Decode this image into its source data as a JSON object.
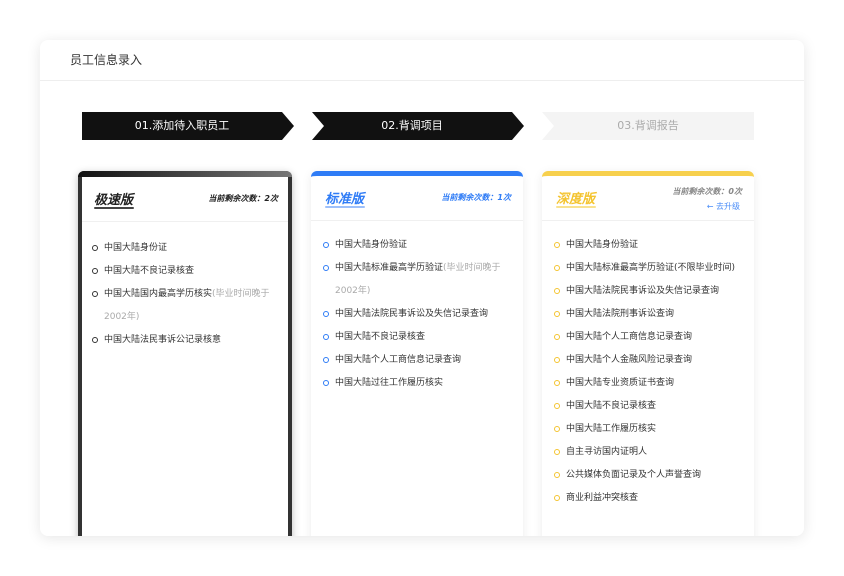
{
  "header": {
    "title": "员工信息录入"
  },
  "steps": [
    {
      "label": "01.添加待入职员工",
      "state": "done"
    },
    {
      "label": "02.背调项目",
      "state": "active"
    },
    {
      "label": "03.背调报告",
      "state": "pending"
    }
  ],
  "colors": {
    "step_active": "#111111",
    "step_pending": "#f4f4f4",
    "standard_accent": "#2f7cf6",
    "deep_accent": "#f7d04d",
    "fast_accent": "#333333"
  },
  "cards": [
    {
      "name": "极速版",
      "remaining": "当前剩余次数：2次",
      "items": [
        {
          "text": "中国大陆身份证",
          "note": ""
        },
        {
          "text": "中国大陆不良记录核查",
          "note": ""
        },
        {
          "text": "中国大陆国内最高学历核实",
          "note": "(毕业时间晚于2002年)"
        },
        {
          "text": "中国大陆法民事诉公记录核意",
          "note": ""
        }
      ]
    },
    {
      "name": "标准版",
      "remaining": "当前剩余次数：1次",
      "items": [
        {
          "text": "中国大陆身份验证",
          "note": ""
        },
        {
          "text": "中国大陆标准最高学历验证",
          "note": "(毕业时间晚于2002年)"
        },
        {
          "text": "中国大陆法院民事诉讼及失信记录查询",
          "note": ""
        },
        {
          "text": "中国大陆不良记录核查",
          "note": ""
        },
        {
          "text": "中国大陆个人工商信息记录查询",
          "note": ""
        },
        {
          "text": "中国大陆过往工作履历核实",
          "note": ""
        }
      ]
    },
    {
      "name": "深度版",
      "remaining": "当前剩余次数：0次",
      "upgrade": "← 去升级",
      "items": [
        {
          "text": "中国大陆身份验证",
          "note": ""
        },
        {
          "text": "中国大陆标准最高学历验证(不限毕业时间)",
          "note": ""
        },
        {
          "text": "中国大陆法院民事诉讼及失信记录查询",
          "note": ""
        },
        {
          "text": "中国大陆法院刑事诉讼查询",
          "note": ""
        },
        {
          "text": "中国大陆个人工商信息记录查询",
          "note": ""
        },
        {
          "text": "中国大陆个人金融风险记录查询",
          "note": ""
        },
        {
          "text": "中国大陆专业资质证书查询",
          "note": ""
        },
        {
          "text": "中国大陆不良记录核查",
          "note": ""
        },
        {
          "text": "中国大陆工作履历核实",
          "note": ""
        },
        {
          "text": "自主寻访国内证明人",
          "note": ""
        },
        {
          "text": "公共媒体负面记录及个人声誉查询",
          "note": ""
        },
        {
          "text": "商业利益冲突核查",
          "note": ""
        }
      ]
    }
  ]
}
